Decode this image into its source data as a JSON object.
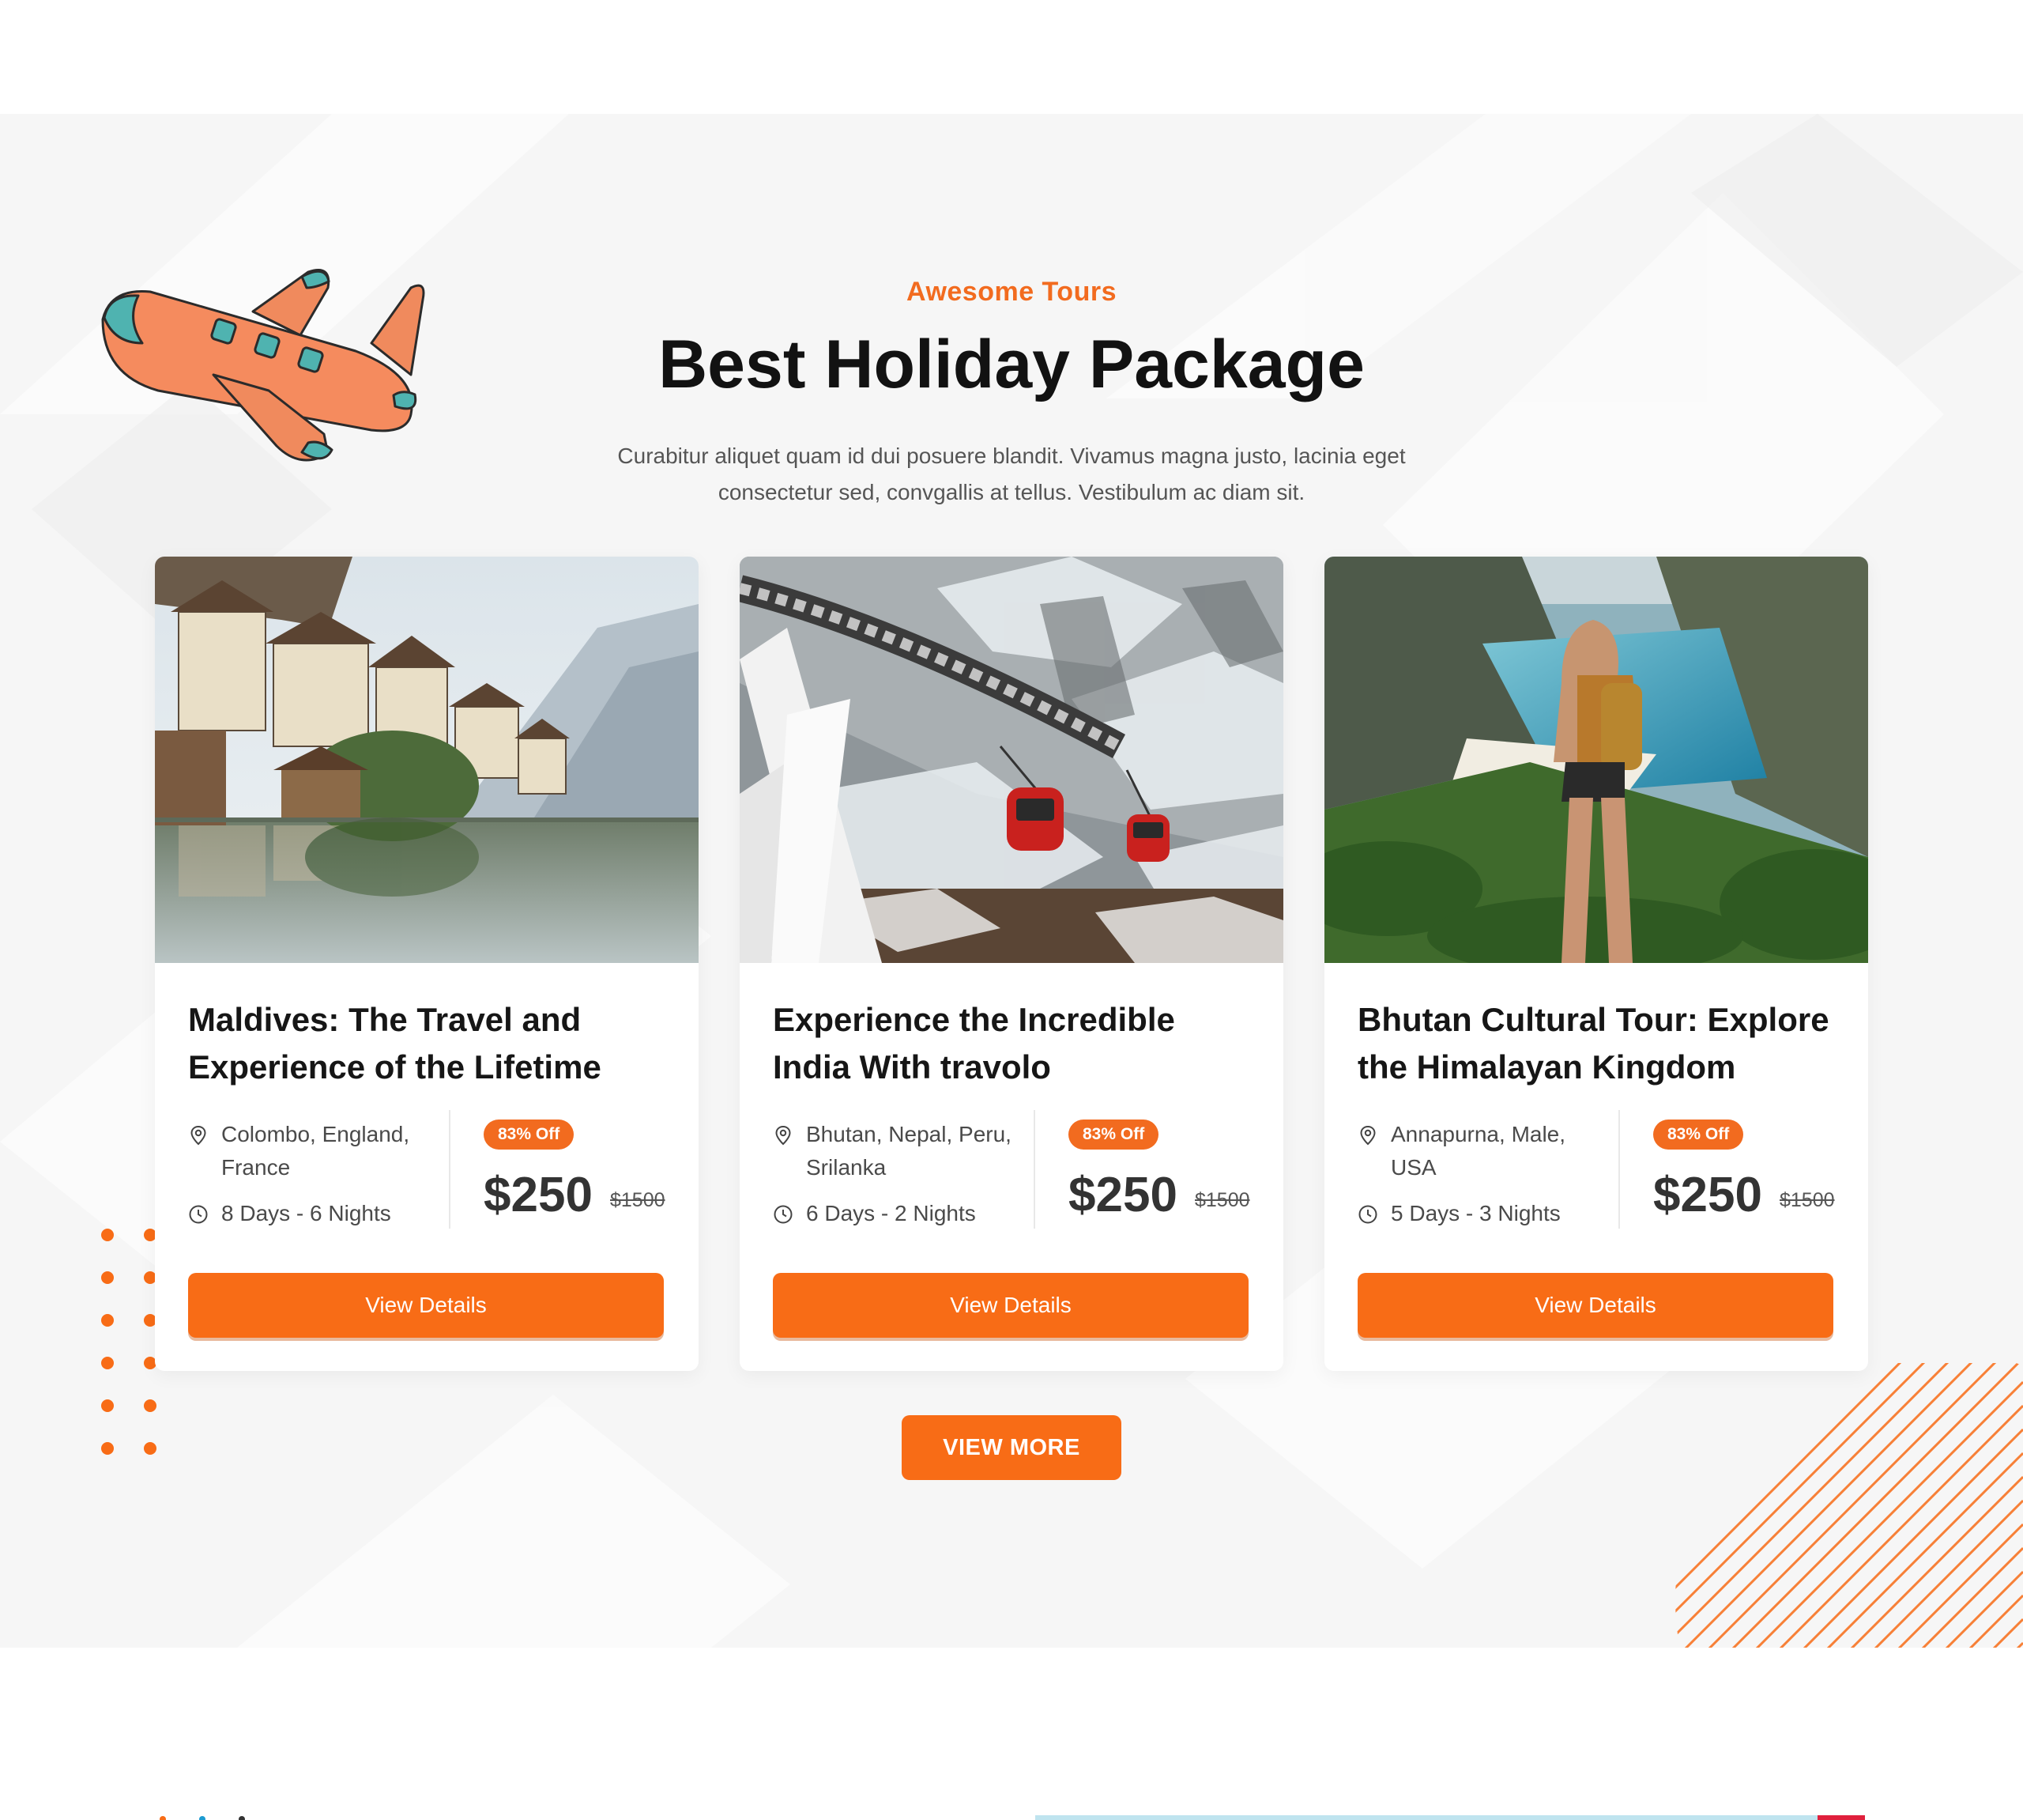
{
  "section": {
    "eyebrow": "Awesome Tours",
    "title": "Best Holiday Package",
    "subtitle": "Curabitur aliquet quam id dui posuere blandit. Vivamus magna justo, lacinia eget consectetur sed, convgallis at tellus. Vestibulum ac diam sit."
  },
  "cards": [
    {
      "title": "Maldives: The Travel and Experience of the Lifetime",
      "location": "Colombo, England, France",
      "duration": "8 Days - 6 Nights",
      "badge": "83% Off",
      "price": "$250",
      "old_price": "$1500",
      "button": "View Details"
    },
    {
      "title": "Experience the Incredible India With travolo",
      "location": "Bhutan, Nepal, Peru, Srilanka",
      "duration": "6 Days - 2 Nights",
      "badge": "83% Off",
      "price": "$250",
      "old_price": "$1500",
      "button": "View Details"
    },
    {
      "title": "Bhutan Cultural Tour: Explore the Himalayan Kingdom",
      "location": "Annapurna, Male, USA",
      "duration": "5 Days - 3 Nights",
      "badge": "83% Off",
      "price": "$250",
      "old_price": "$1500",
      "button": "View Details"
    }
  ],
  "view_more": "VIEW MORE",
  "colors": {
    "accent": "#f86c16",
    "eyebrow": "#f26b1f",
    "section_bg": "#f6f6f6"
  },
  "icons": [
    "location-pin-icon",
    "clock-icon",
    "airplane-illustration"
  ]
}
